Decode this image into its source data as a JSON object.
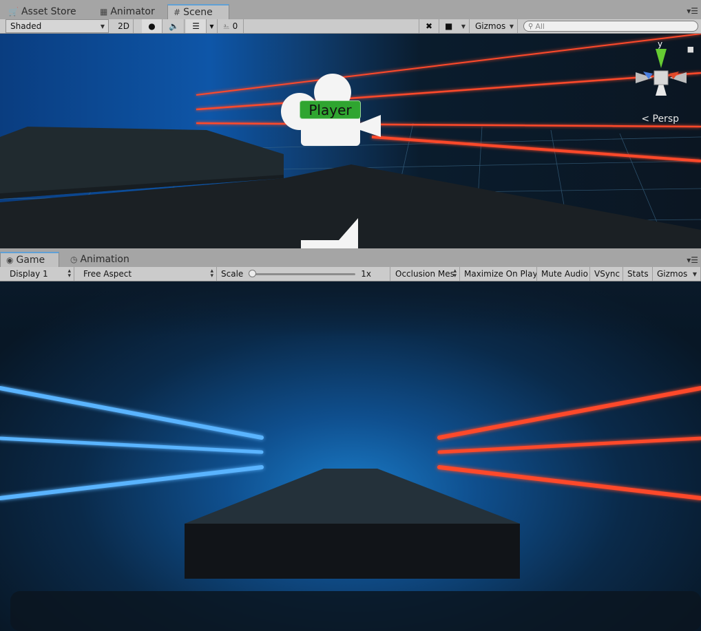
{
  "scene_panel": {
    "tabs": [
      {
        "label": "Asset Store",
        "icon": "bag-icon"
      },
      {
        "label": "Animator",
        "icon": "animator-icon"
      },
      {
        "label": "Scene",
        "icon": "grid-icon"
      }
    ],
    "toolbar": {
      "draw_mode": "Shaded",
      "mode_2d": "2D",
      "hidden_count": "0",
      "gizmos": "Gizmos",
      "search_placeholder": "All"
    },
    "viewport": {
      "player_label": "Player",
      "projection_label": "Persp",
      "gizmo_axis_label": "y"
    }
  },
  "game_panel": {
    "tabs": [
      {
        "label": "Game",
        "icon": "game-icon"
      },
      {
        "label": "Animation",
        "icon": "clock-icon"
      }
    ],
    "toolbar": {
      "display": "Display 1",
      "aspect": "Free Aspect",
      "scale_label": "Scale",
      "scale_value": "1x",
      "occlusion": "Occlusion Mes",
      "maximize": "Maximize On Play",
      "mute": "Mute Audio",
      "vsync": "VSync",
      "stats": "Stats",
      "gizmos": "Gizmos"
    }
  },
  "colors": {
    "player_label_bg": "#2fa530",
    "laser_red": "#ff4a2a",
    "laser_blue": "#5ab4ff",
    "active_tab_accent": "#5fa0d6"
  }
}
